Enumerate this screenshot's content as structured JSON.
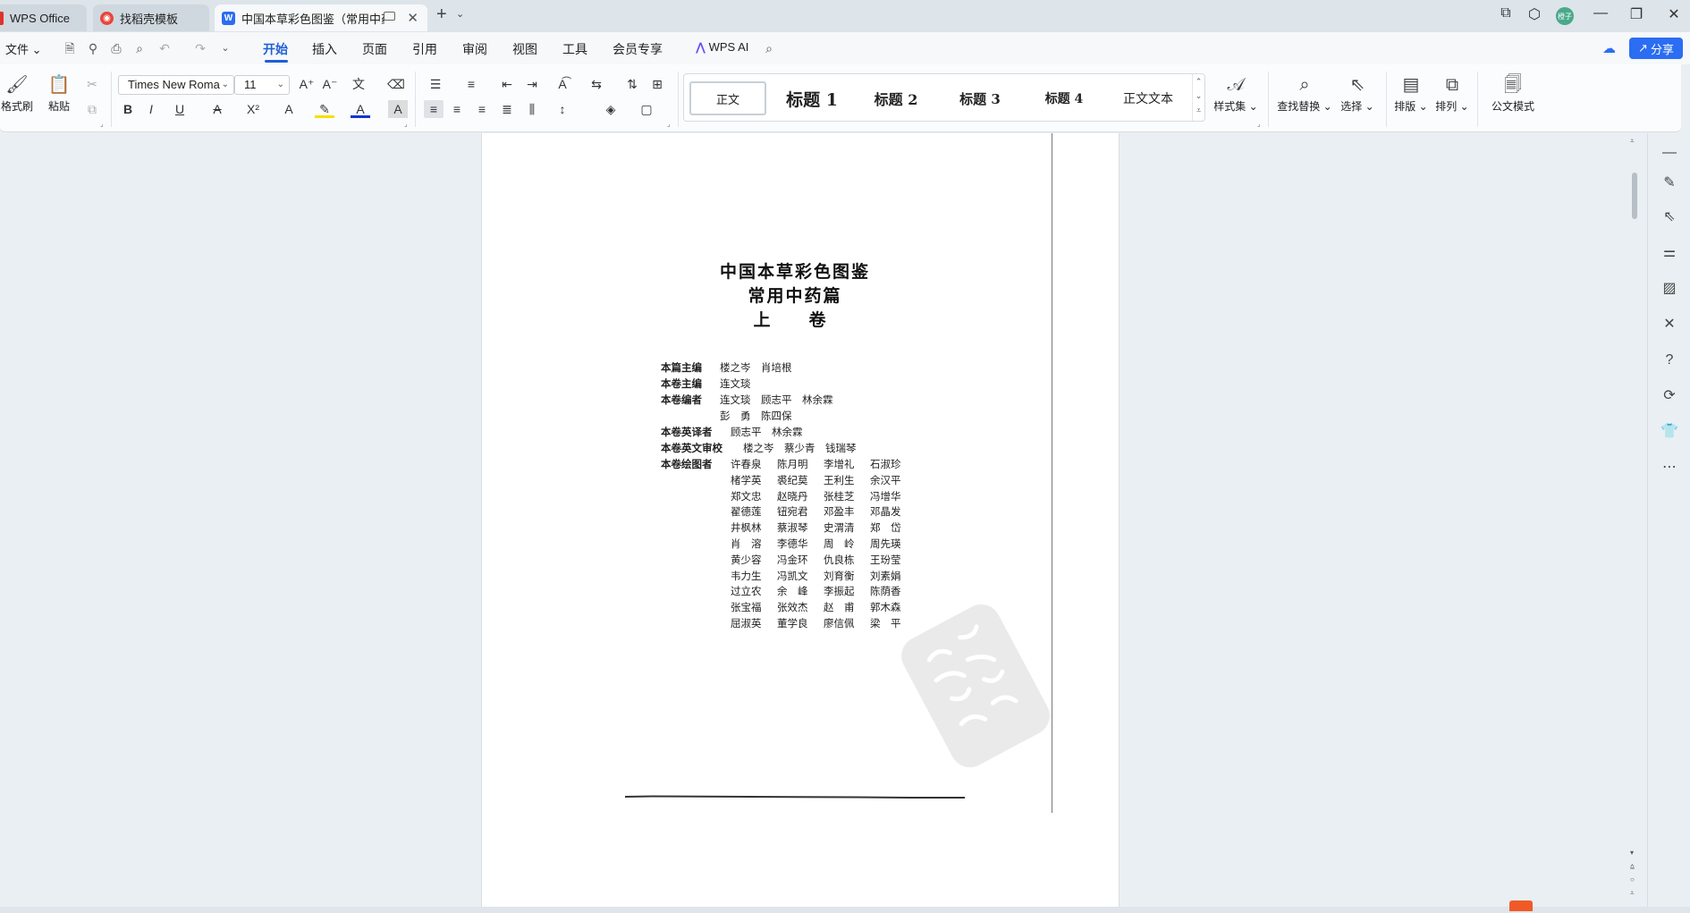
{
  "tabs": [
    {
      "label": "WPS Office",
      "icon": "wps-logo-icon",
      "state": "inactive"
    },
    {
      "label": "找稻壳模板",
      "icon": "docer-icon",
      "state": "inactive"
    },
    {
      "label": "中国本草彩色图鉴（常用中药篇",
      "icon": "word-doc-icon",
      "state": "active"
    }
  ],
  "titlebar": {
    "new_tab": "+",
    "avatar_text": "橙子"
  },
  "menu": {
    "file": "文件",
    "items": [
      "开始",
      "插入",
      "页面",
      "引用",
      "审阅",
      "视图",
      "工具",
      "会员专享"
    ],
    "active": "开始",
    "wps_ai": "WPS AI",
    "share": "分享"
  },
  "ribbon": {
    "format_painter": "格式刷",
    "paste": "粘贴",
    "font_name": "Times New Roma",
    "font_size": "11",
    "styles": [
      "正文",
      "标题 1",
      "标题 2",
      "标题 3",
      "标题 4",
      "正文文本"
    ],
    "style_set": "样式集",
    "find_replace": "查找替换",
    "select": "选择",
    "layout": "排版",
    "arrange": "排列",
    "official_mode": "公文模式"
  },
  "document": {
    "title_lines": [
      "中国本草彩色图鉴",
      "常用中药篇",
      "上　卷"
    ],
    "credits": [
      {
        "label": "本篇主编",
        "names": "楼之岑　肖培根"
      },
      {
        "label": "本卷主编",
        "names": "连文琰"
      },
      {
        "label": "本卷编者",
        "names": "连文琰　顾志平　林余霖"
      },
      {
        "label": "",
        "names": "彭　勇　陈四保"
      },
      {
        "label": "本卷英译者",
        "names": "顾志平　林余霖"
      },
      {
        "label": "本卷英文审校",
        "names": "楼之岑　蔡少青　钱瑞琴"
      },
      {
        "label": "本卷绘图者",
        "names": ""
      }
    ],
    "illustrators": [
      [
        "许春泉",
        "陈月明",
        "李增礼",
        "石淑珍"
      ],
      [
        "楮学英",
        "裘纪莫",
        "王利生",
        "余汉平"
      ],
      [
        "郑文忠",
        "赵晓丹",
        "张桂芝",
        "冯增华"
      ],
      [
        "翟德莲",
        "钮宛君",
        "邓盈丰",
        "邓晶发"
      ],
      [
        "井枫林",
        "蔡淑琴",
        "史渭清",
        "郑　岱"
      ],
      [
        "肖　溶",
        "李德华",
        "周　岭",
        "周先瑛"
      ],
      [
        "黄少容",
        "冯金环",
        "仇良栋",
        "王玢莹"
      ],
      [
        "韦力生",
        "冯凯文",
        "刘育衡",
        "刘素娟"
      ],
      [
        "过立农",
        "余　峰",
        "李振起",
        "陈荫香"
      ],
      [
        "张宝福",
        "张效杰",
        "赵　甫",
        "郭木森"
      ],
      [
        "屈淑英",
        "董学良",
        "廖信佩",
        "梁　平"
      ]
    ]
  },
  "sidebar_icons": [
    "minimize-panel-icon",
    "pen-icon",
    "cursor-select-icon",
    "adjust-icon",
    "image-edit-icon",
    "tools-icon",
    "help-icon",
    "sync-icon",
    "shirt-icon",
    "more-icon"
  ]
}
